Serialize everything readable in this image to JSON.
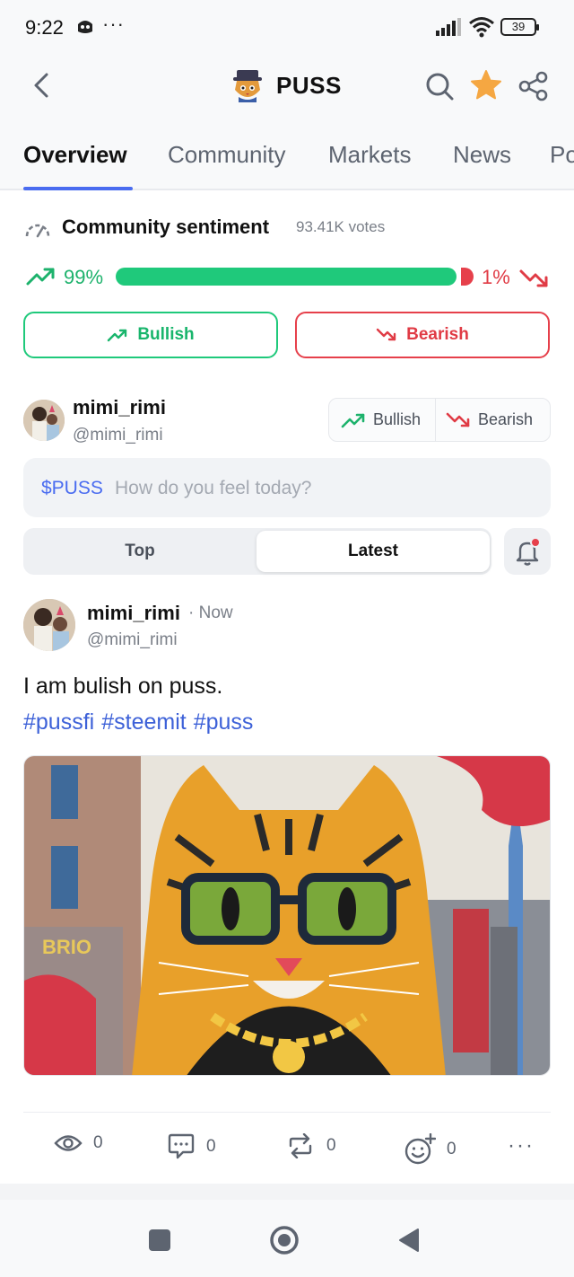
{
  "status_bar": {
    "time": "9:22",
    "battery": "39"
  },
  "header": {
    "title": "PUSS"
  },
  "tabs": [
    {
      "label": "Overview",
      "active": true
    },
    {
      "label": "Community",
      "active": false
    },
    {
      "label": "Markets",
      "active": false
    },
    {
      "label": "News",
      "active": false
    },
    {
      "label": "Po",
      "active": false
    }
  ],
  "sentiment": {
    "title": "Community sentiment",
    "votes": "93.41K votes",
    "bullish_pct_label": "99%",
    "bearish_pct_label": "1%",
    "bullish_fraction": 0.99,
    "bullish_button": "Bullish",
    "bearish_button": "Bearish"
  },
  "composer": {
    "user_name": "mimi_rimi",
    "user_handle": "@mimi_rimi",
    "bullish_label": "Bullish",
    "bearish_label": "Bearish",
    "ticker": "$PUSS",
    "placeholder": "How do you feel today?"
  },
  "feed_toggle": {
    "top": "Top",
    "latest": "Latest",
    "selected": "Latest"
  },
  "post": {
    "user_name": "mimi_rimi",
    "time": "· Now",
    "user_handle": "@mimi_rimi",
    "text": "I am bulish on puss.",
    "tags": [
      "#pussfi",
      "#steemit",
      "#puss"
    ],
    "image_alt": "Illustrated cat wearing glasses and a gold chain in a city",
    "views": "0",
    "comments": "0",
    "reposts": "0",
    "reactions": "0"
  },
  "colors": {
    "accent": "#4a6cf0",
    "bullish": "#1fc97b",
    "bearish": "#e6404b",
    "tag": "#3d61d8"
  }
}
